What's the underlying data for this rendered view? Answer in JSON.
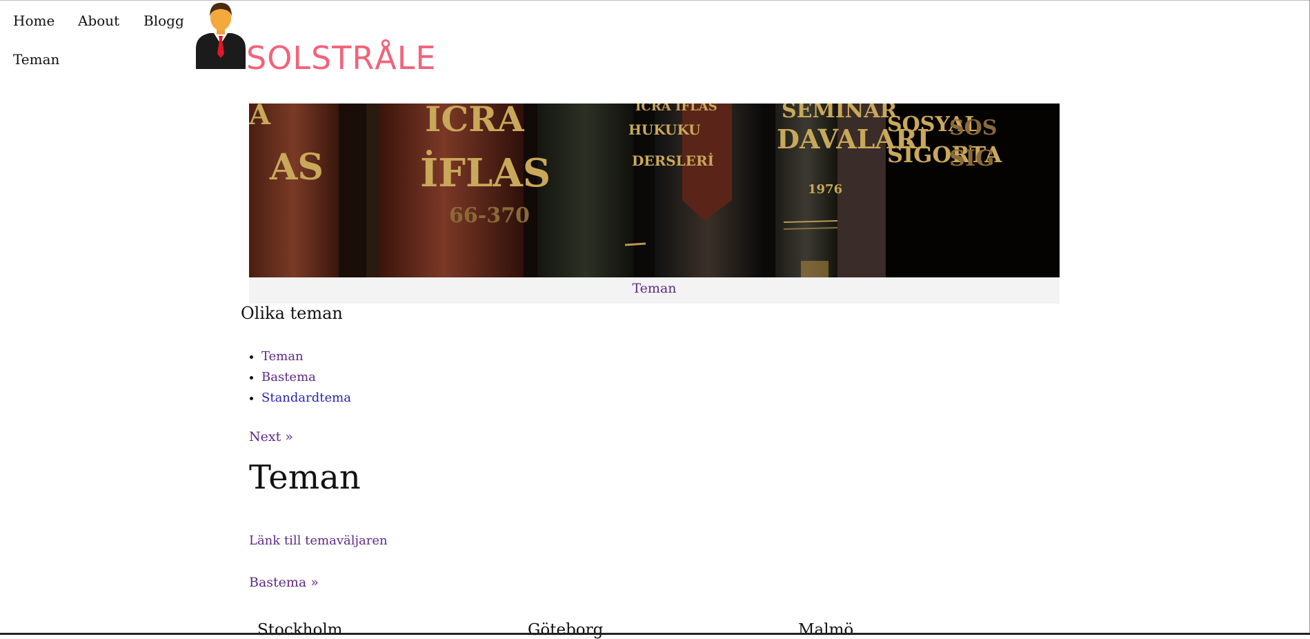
{
  "nav": {
    "items": [
      {
        "label": "Home"
      },
      {
        "label": "About"
      },
      {
        "label": "Blogg"
      },
      {
        "label": "Teman"
      }
    ]
  },
  "logo": {
    "text": "SOLSTRÅLE",
    "icon": "businessman-icon",
    "text_color": "#f2637a"
  },
  "hero": {
    "caption_link": "Teman",
    "spine_texts": [
      "ICRA",
      "İFLAS",
      "ICRA İFLAS",
      "HUKUKU",
      "DERSLERİ",
      "SEMİNAR",
      "DAVALARI",
      "1976",
      "SOSYAL",
      "SİGORTA"
    ]
  },
  "sidebar_section": {
    "title": "Olika teman",
    "items": [
      {
        "label": "Teman"
      },
      {
        "label": "Bastema"
      },
      {
        "label": "Standardtema"
      }
    ]
  },
  "pager": {
    "next": "Next »"
  },
  "main": {
    "heading": "Teman",
    "theme_picker_link": "Länk till temaväljaren",
    "next_page_link": "Bastema »"
  },
  "footer": {
    "cities": [
      "Stockholm",
      "Göteborg",
      "Malmö"
    ]
  },
  "colors": {
    "link_visited": "#5c2a86",
    "link_unvisited": "#2027b6",
    "caption_bg": "#f3f3f3"
  }
}
